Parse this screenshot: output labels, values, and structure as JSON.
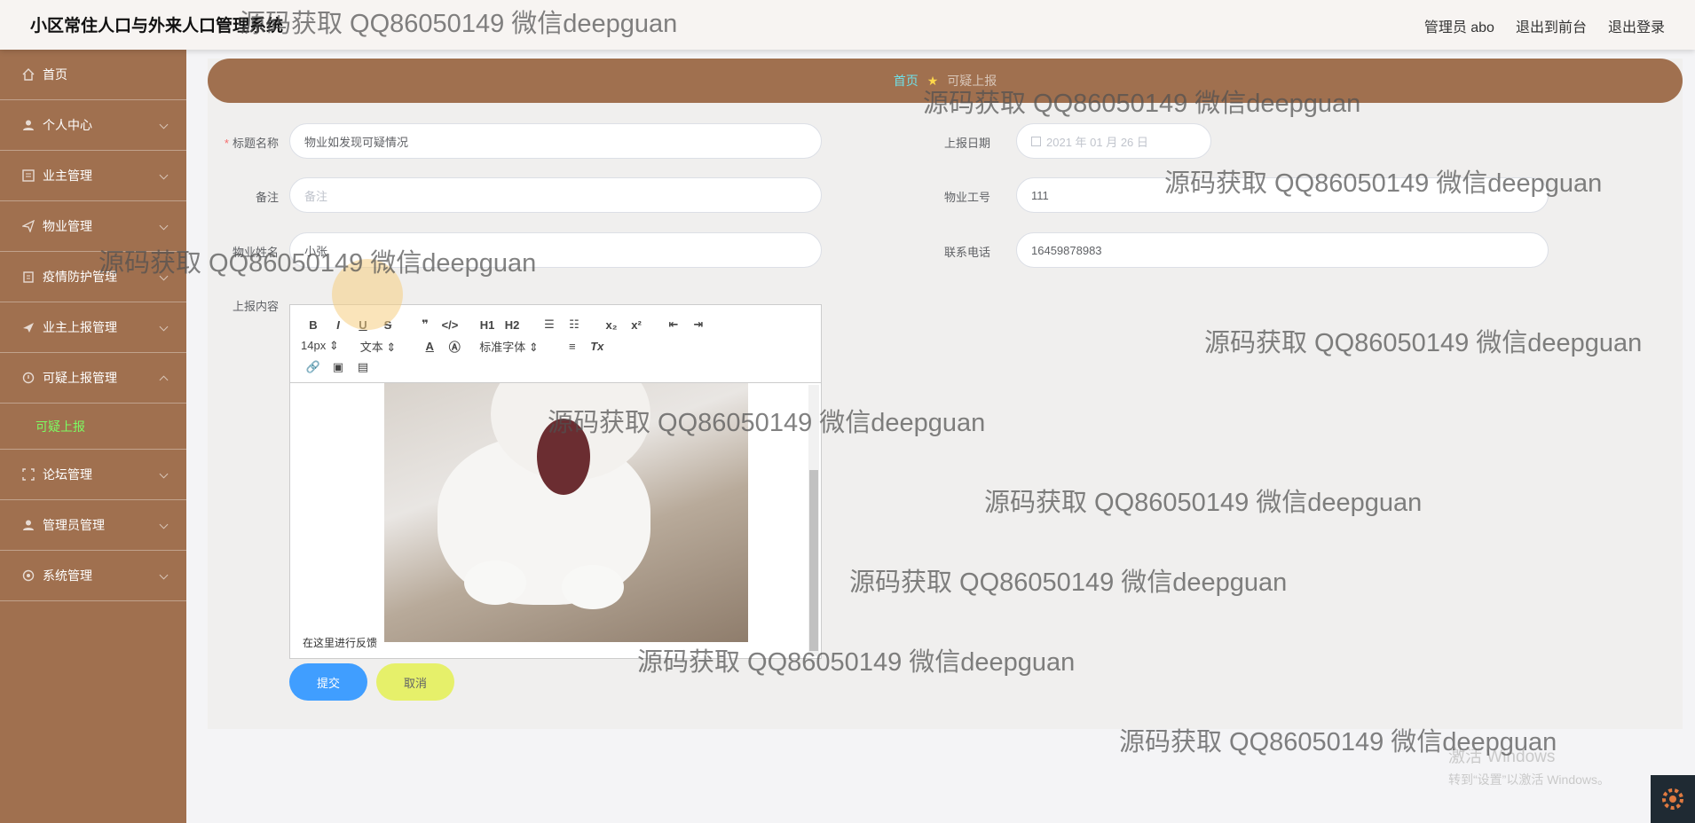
{
  "app": {
    "title": "小区常住人口与外来人口管理系统"
  },
  "topnav": {
    "admin": "管理员 abo",
    "to_front": "退出到前台",
    "logout": "退出登录"
  },
  "sidebar": {
    "items": [
      {
        "label": "首页",
        "icon": "home-icon"
      },
      {
        "label": "个人中心",
        "icon": "user-icon"
      },
      {
        "label": "业主管理",
        "icon": "list-icon"
      },
      {
        "label": "物业管理",
        "icon": "send-icon"
      },
      {
        "label": "疫情防护管理",
        "icon": "shield-icon"
      },
      {
        "label": "业主上报管理",
        "icon": "plane-icon"
      },
      {
        "label": "可疑上报管理",
        "icon": "warning-icon"
      },
      {
        "label": "论坛管理",
        "icon": "forum-icon"
      },
      {
        "label": "管理员管理",
        "icon": "admin-icon"
      },
      {
        "label": "系统管理",
        "icon": "gear-icon"
      }
    ],
    "sub_item": "可疑上报"
  },
  "breadcrumb": {
    "home": "首页",
    "current": "可疑上报"
  },
  "form": {
    "title_label": "标题名称",
    "title_value": "物业如发现可疑情况",
    "date_label": "上报日期",
    "date_value": "2021 年 01 月 26 日",
    "remark_label": "备注",
    "remark_placeholder": "备注",
    "staff_id_label": "物业工号",
    "staff_id_value": "111",
    "staff_name_label": "物业姓名",
    "staff_name_value": "小张",
    "phone_label": "联系电话",
    "phone_value": "16459878983",
    "content_label": "上报内容",
    "content_text": "在这里进行反馈",
    "submit": "提交",
    "cancel": "取消"
  },
  "editor_toolbar": {
    "font_size": "14px",
    "paragraph": "文本",
    "font_family": "标准字体",
    "h1": "H1",
    "h2": "H2"
  },
  "watermark": "源码获取 QQ86050149 微信deepguan",
  "windows": {
    "line1": "激活 Windows",
    "line2": "转到“设置”以激活 Windows。"
  },
  "colors": {
    "sidebar": "#a0704f",
    "submit": "#409eff",
    "cancel": "#e6f06a",
    "active_sub": "#7cfc62"
  }
}
